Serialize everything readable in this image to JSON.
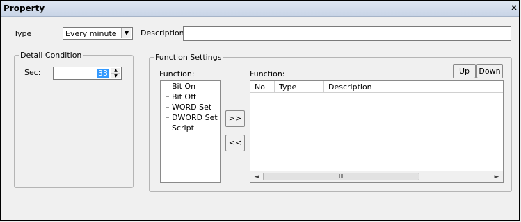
{
  "window": {
    "title": "Property",
    "close_glyph": "×"
  },
  "type_field": {
    "label": "Type",
    "value": "Every minute",
    "arrow": "▼"
  },
  "description": {
    "label": "Description:",
    "value": ""
  },
  "detail_condition": {
    "legend": "Detail Condition",
    "sec_label": "Sec:",
    "sec_value": "33",
    "up_glyph": "▲",
    "down_glyph": "▼"
  },
  "function_settings": {
    "legend": "Function Settings",
    "available_label": "Function:",
    "available_items": [
      "Bit On",
      "Bit Off",
      "WORD Set",
      "DWORD Set",
      "Script"
    ],
    "add_button": ">>",
    "remove_button": "<<",
    "selected_label": "Function:",
    "up_button": "Up",
    "down_button": "Down",
    "columns": [
      "No",
      "Type",
      "Description"
    ],
    "rows": [],
    "scroll_left": "◄",
    "scroll_right": "►",
    "scroll_thumb": "III"
  }
}
